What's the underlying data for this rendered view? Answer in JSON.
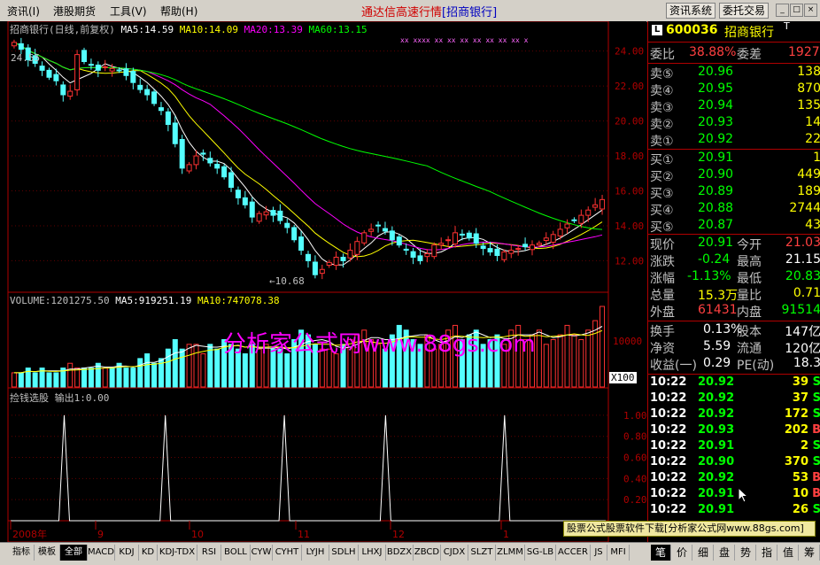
{
  "menu": {
    "items": [
      "资讯(I)",
      "港股期货",
      "工具(V)",
      "帮助(H)"
    ]
  },
  "app": {
    "title": "通达信高速行情",
    "subtitle": "[招商银行]"
  },
  "top_buttons": [
    "资讯系统",
    "委托交易"
  ],
  "window_buttons": [
    "_",
    "□",
    "×"
  ],
  "price_panel": {
    "header": {
      "name": "招商银行(日线,前复权)",
      "ma5": "MA5:14.59",
      "ma10": "MA10:14.09",
      "ma20": "MA20:13.39",
      "ma60": "MA60:13.15"
    },
    "high_label": "24.55",
    "low_label": "←10.68",
    "y_ticks": [
      "24.00",
      "22.00",
      "20.00",
      "18.00",
      "16.00",
      "14.00",
      "12.00"
    ]
  },
  "volume_panel": {
    "header": {
      "volume": "VOLUME:1201275.50",
      "ma5": "MA5:919251.19",
      "ma10": "MA10:747078.38"
    },
    "y_tick": "10000",
    "unit": "X100"
  },
  "indicator_panel": {
    "header": {
      "name": "捡钱选股",
      "output": "输出1:0.00"
    },
    "y_ticks": [
      "1.00",
      "0.80",
      "0.60",
      "0.40",
      "0.20"
    ]
  },
  "watermark": "分析家公式网www.88gs.com",
  "date_axis": {
    "labels": [
      "2008年",
      "9",
      "10",
      "11",
      "12",
      "1"
    ]
  },
  "chart_data": [
    {
      "type": "candlestick",
      "title": "招商银行(日线,前复权)",
      "ylim": [
        10.5,
        25.2
      ],
      "y_ticks": [
        24,
        22,
        20,
        18,
        16,
        14,
        12
      ],
      "high": 24.55,
      "low": 10.68,
      "close_series": [
        24.5,
        24.1,
        23.5,
        23.3,
        22.9,
        22.5,
        22.3,
        21.5,
        21.7,
        23.8,
        23.4,
        23.2,
        22.9,
        23.1,
        23.0,
        22.9,
        22.6,
        22.2,
        21.8,
        21.5,
        21.0,
        20.6,
        19.8,
        18.7,
        17.3,
        17.5,
        18.0,
        18.1,
        17.6,
        17.3,
        16.8,
        16.2,
        15.6,
        15.2,
        14.5,
        14.7,
        14.8,
        14.6,
        14.3,
        13.9,
        13.2,
        12.6,
        12.0,
        11.2,
        11.5,
        11.9,
        12.2,
        12.0,
        12.6,
        13.1,
        13.6,
        13.8,
        14.0,
        13.7,
        13.2,
        12.9,
        12.6,
        12.2,
        12.0,
        12.4,
        12.9,
        13.0,
        13.2,
        13.6,
        13.5,
        13.3,
        13.0,
        12.7,
        12.5,
        12.3,
        12.5,
        12.6,
        12.7,
        12.8,
        12.9,
        13.0,
        13.3,
        13.5,
        13.8,
        14.1,
        14.3,
        14.6,
        14.9,
        15.2,
        15.5
      ],
      "ma_series": [
        {
          "name": "MA5",
          "value": 14.59,
          "color": "#ffffff"
        },
        {
          "name": "MA10",
          "value": 14.09,
          "color": "#ffff00"
        },
        {
          "name": "MA20",
          "value": 13.39,
          "color": "#ff00ff"
        },
        {
          "name": "MA60",
          "value": 13.15,
          "color": "#00ff00"
        }
      ]
    },
    {
      "type": "bar",
      "title": "VOLUME",
      "volume": 1201275.5,
      "ma5": 919251.19,
      "ma10": 747078.38,
      "unit": "X100",
      "y_ticks": [
        10000
      ],
      "values": [
        3,
        3,
        4,
        3,
        4,
        3,
        3,
        4,
        5,
        4,
        4,
        4,
        5,
        4,
        4,
        5,
        4,
        4,
        6,
        7,
        5,
        6,
        8,
        10,
        8,
        9,
        9,
        7,
        9,
        8,
        10,
        9,
        8,
        7,
        9,
        8,
        9,
        8,
        8,
        7,
        10,
        12,
        11,
        9,
        8,
        8,
        7,
        9,
        10,
        11,
        12,
        10,
        9,
        8,
        11,
        13,
        12,
        10,
        9,
        11,
        8,
        9,
        12,
        13,
        10,
        11,
        12,
        9,
        10,
        11,
        9,
        12,
        13,
        10,
        11,
        12,
        9,
        10,
        11,
        13,
        11,
        10,
        12,
        14,
        17
      ]
    },
    {
      "type": "line",
      "title": "捡钱选股",
      "series": [
        {
          "name": "输出1",
          "value": 0.0
        }
      ],
      "ylim": [
        0,
        1.1
      ],
      "y_ticks": [
        1.0,
        0.8,
        0.6,
        0.4,
        0.2
      ],
      "signal_positions": [
        0.09,
        0.26,
        0.46,
        0.63,
        0.83
      ]
    }
  ],
  "quote": {
    "code": "600036",
    "name": "招商银行",
    "badge": "T",
    "weibi": {
      "label": "委比",
      "value": "38.88%",
      "label2": "委差",
      "value2": "1927"
    },
    "sells": [
      {
        "label": "卖⑤",
        "price": "20.96",
        "vol": "138"
      },
      {
        "label": "卖④",
        "price": "20.95",
        "vol": "870"
      },
      {
        "label": "卖③",
        "price": "20.94",
        "vol": "135"
      },
      {
        "label": "卖②",
        "price": "20.93",
        "vol": "14"
      },
      {
        "label": "卖①",
        "price": "20.92",
        "vol": "22"
      }
    ],
    "buys": [
      {
        "label": "买①",
        "price": "20.91",
        "vol": "1"
      },
      {
        "label": "买②",
        "price": "20.90",
        "vol": "449"
      },
      {
        "label": "买③",
        "price": "20.89",
        "vol": "189"
      },
      {
        "label": "买④",
        "price": "20.88",
        "vol": "2744"
      },
      {
        "label": "买⑤",
        "price": "20.87",
        "vol": "43"
      }
    ],
    "stats": [
      {
        "l1": "现价",
        "v1": "20.91",
        "l2": "今开",
        "v2": "21.03",
        "c1": "#00ff00",
        "c2": "#ff4040"
      },
      {
        "l1": "涨跌",
        "v1": "-0.24",
        "l2": "最高",
        "v2": "21.15",
        "c1": "#00ff00",
        "c2": "#ffffff"
      },
      {
        "l1": "涨幅",
        "v1": "-1.13%",
        "l2": "最低",
        "v2": "20.83",
        "c1": "#00ff00",
        "c2": "#00ff00"
      },
      {
        "l1": "总量",
        "v1": "15.3万",
        "l2": "量比",
        "v2": "0.71",
        "c1": "#ffff00",
        "c2": "#ffff00"
      },
      {
        "l1": "外盘",
        "v1": "61431",
        "l2": "内盘",
        "v2": "91514",
        "c1": "#ff4040",
        "c2": "#00ff00"
      }
    ],
    "fundamentals": [
      {
        "l1": "换手",
        "v1": "0.13%",
        "l2": "股本",
        "v2": "147亿"
      },
      {
        "l1": "净资",
        "v1": "5.59",
        "l2": "流通",
        "v2": "120亿"
      },
      {
        "l1": "收益(一)",
        "v1": "0.29",
        "l2": "PE(动)",
        "v2": "18.3"
      }
    ],
    "ticks": [
      {
        "time": "10:22",
        "price": "20.92",
        "vol": "39",
        "side": "S"
      },
      {
        "time": "10:22",
        "price": "20.92",
        "vol": "37",
        "side": "S"
      },
      {
        "time": "10:22",
        "price": "20.92",
        "vol": "172",
        "side": "S"
      },
      {
        "time": "10:22",
        "price": "20.93",
        "vol": "202",
        "side": "B"
      },
      {
        "time": "10:22",
        "price": "20.91",
        "vol": "2",
        "side": "S"
      },
      {
        "time": "10:22",
        "price": "20.90",
        "vol": "370",
        "side": "S"
      },
      {
        "time": "10:22",
        "price": "20.92",
        "vol": "53",
        "side": "B"
      },
      {
        "time": "10:22",
        "price": "20.91",
        "vol": "10",
        "side": "B"
      },
      {
        "time": "10:22",
        "price": "20.91",
        "vol": "26",
        "side": "S"
      }
    ]
  },
  "banner": "股票公式股票软件下载[分析家公式网www.88gs.com]",
  "bottom_tabs": {
    "left": [
      "指标",
      "模板",
      "全部",
      "MACD",
      "KDJ",
      "KD",
      "KDJ-TDX",
      "RSI",
      "BOLL",
      "CYW",
      "CYHT",
      "LYJH",
      "SDLH",
      "LHXJ",
      "BDZX",
      "ZBCD",
      "CJDX",
      "SLZT",
      "ZLMM",
      "SG-LB",
      "ACCER",
      "JS",
      "MFI"
    ],
    "right": [
      "笔",
      "价",
      "细",
      "盘",
      "势",
      "指",
      "值",
      "筹"
    ]
  },
  "colors": {
    "up": "#ff3232",
    "down": "#54ffff",
    "grid": "#b00000",
    "ma5": "#ffffff",
    "ma10": "#ffff00",
    "ma20": "#ff00ff",
    "ma60": "#00ff00"
  }
}
